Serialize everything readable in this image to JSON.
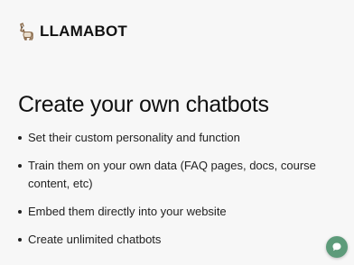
{
  "header": {
    "brand_name": "LLAMABOT",
    "logo_icon": "llama-icon"
  },
  "hero": {
    "headline": "Create your own chatbots"
  },
  "features": [
    "Set their custom personality and function",
    "Train them on your own data (FAQ pages, docs, course content, etc)",
    "Embed them directly into your website",
    "Create unlimited chatbots"
  ],
  "chat_widget": {
    "icon": "chat-bubble-icon",
    "color": "#5d9b7a"
  },
  "colors": {
    "background": "#f7f7f7",
    "text": "#141414"
  }
}
